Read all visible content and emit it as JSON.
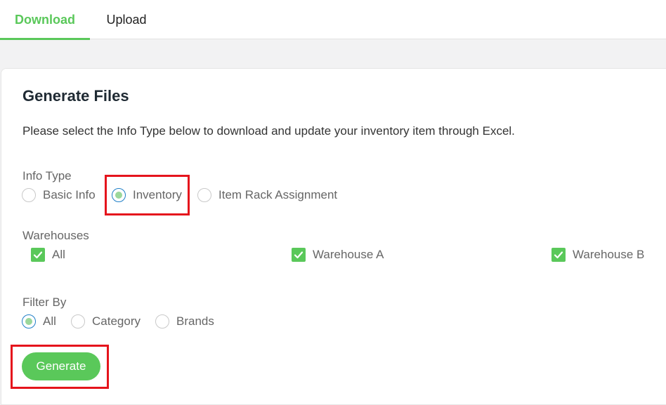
{
  "tabs": [
    {
      "label": "Download",
      "active": true
    },
    {
      "label": "Upload",
      "active": false
    }
  ],
  "card": {
    "title": "Generate Files",
    "description": "Please select the Info Type below to download and update your inventory item through Excel."
  },
  "info_type": {
    "label": "Info Type",
    "options": [
      "Basic Info",
      "Inventory",
      "Item Rack Assignment"
    ],
    "selected": "Inventory"
  },
  "warehouses": {
    "label": "Warehouses",
    "options": [
      "All",
      "Warehouse A",
      "Warehouse B"
    ],
    "checked": [
      "All",
      "Warehouse A",
      "Warehouse B"
    ]
  },
  "filter_by": {
    "label": "Filter By",
    "options": [
      "All",
      "Category",
      "Brands"
    ],
    "selected": "All"
  },
  "generate_button": "Generate",
  "colors": {
    "accent": "#5ac85a",
    "highlight": "#e5141c",
    "radio_ring": "#1f7fc7"
  },
  "icons": {
    "checkbox_checked": "check-icon"
  }
}
